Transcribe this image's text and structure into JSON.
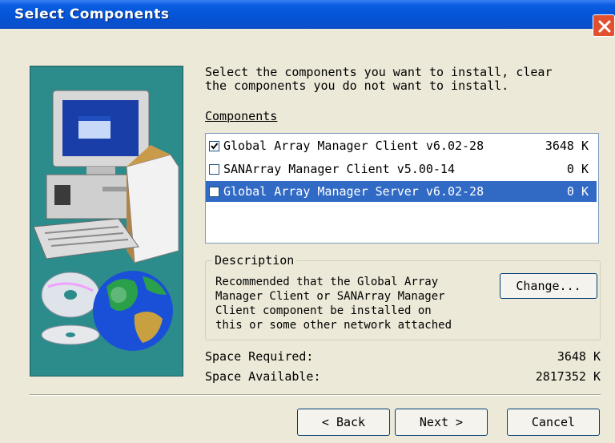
{
  "window": {
    "title": "Select Components"
  },
  "instructions": "Select the components you want to install, clear\nthe components you do not want to install.",
  "components": {
    "label": "Components",
    "items": [
      {
        "name": "Global Array Manager Client v6.02-28",
        "size": "3648 K",
        "checked": true,
        "selected": false
      },
      {
        "name": "SANArray Manager Client v5.00-14",
        "size": "0 K",
        "checked": false,
        "selected": false
      },
      {
        "name": "Global Array Manager Server v6.02-28",
        "size": "0 K",
        "checked": false,
        "selected": true
      }
    ]
  },
  "description": {
    "title": "Description",
    "text": "Recommended that the Global Array\nManager Client or SANArray Manager\nClient component be installed on\nthis or some other network attached",
    "change_label": "Change..."
  },
  "space": {
    "required_label": "Space Required:",
    "required_value": "3648 K",
    "available_label": "Space Available:",
    "available_value": "2817352 K"
  },
  "buttons": {
    "back": "< Back",
    "next": "Next >",
    "cancel": "Cancel"
  },
  "colors": {
    "titlebar": "#0453d6",
    "selection": "#316ac5",
    "side_panel": "#2c8c8c",
    "dialog": "#ece9d8"
  }
}
